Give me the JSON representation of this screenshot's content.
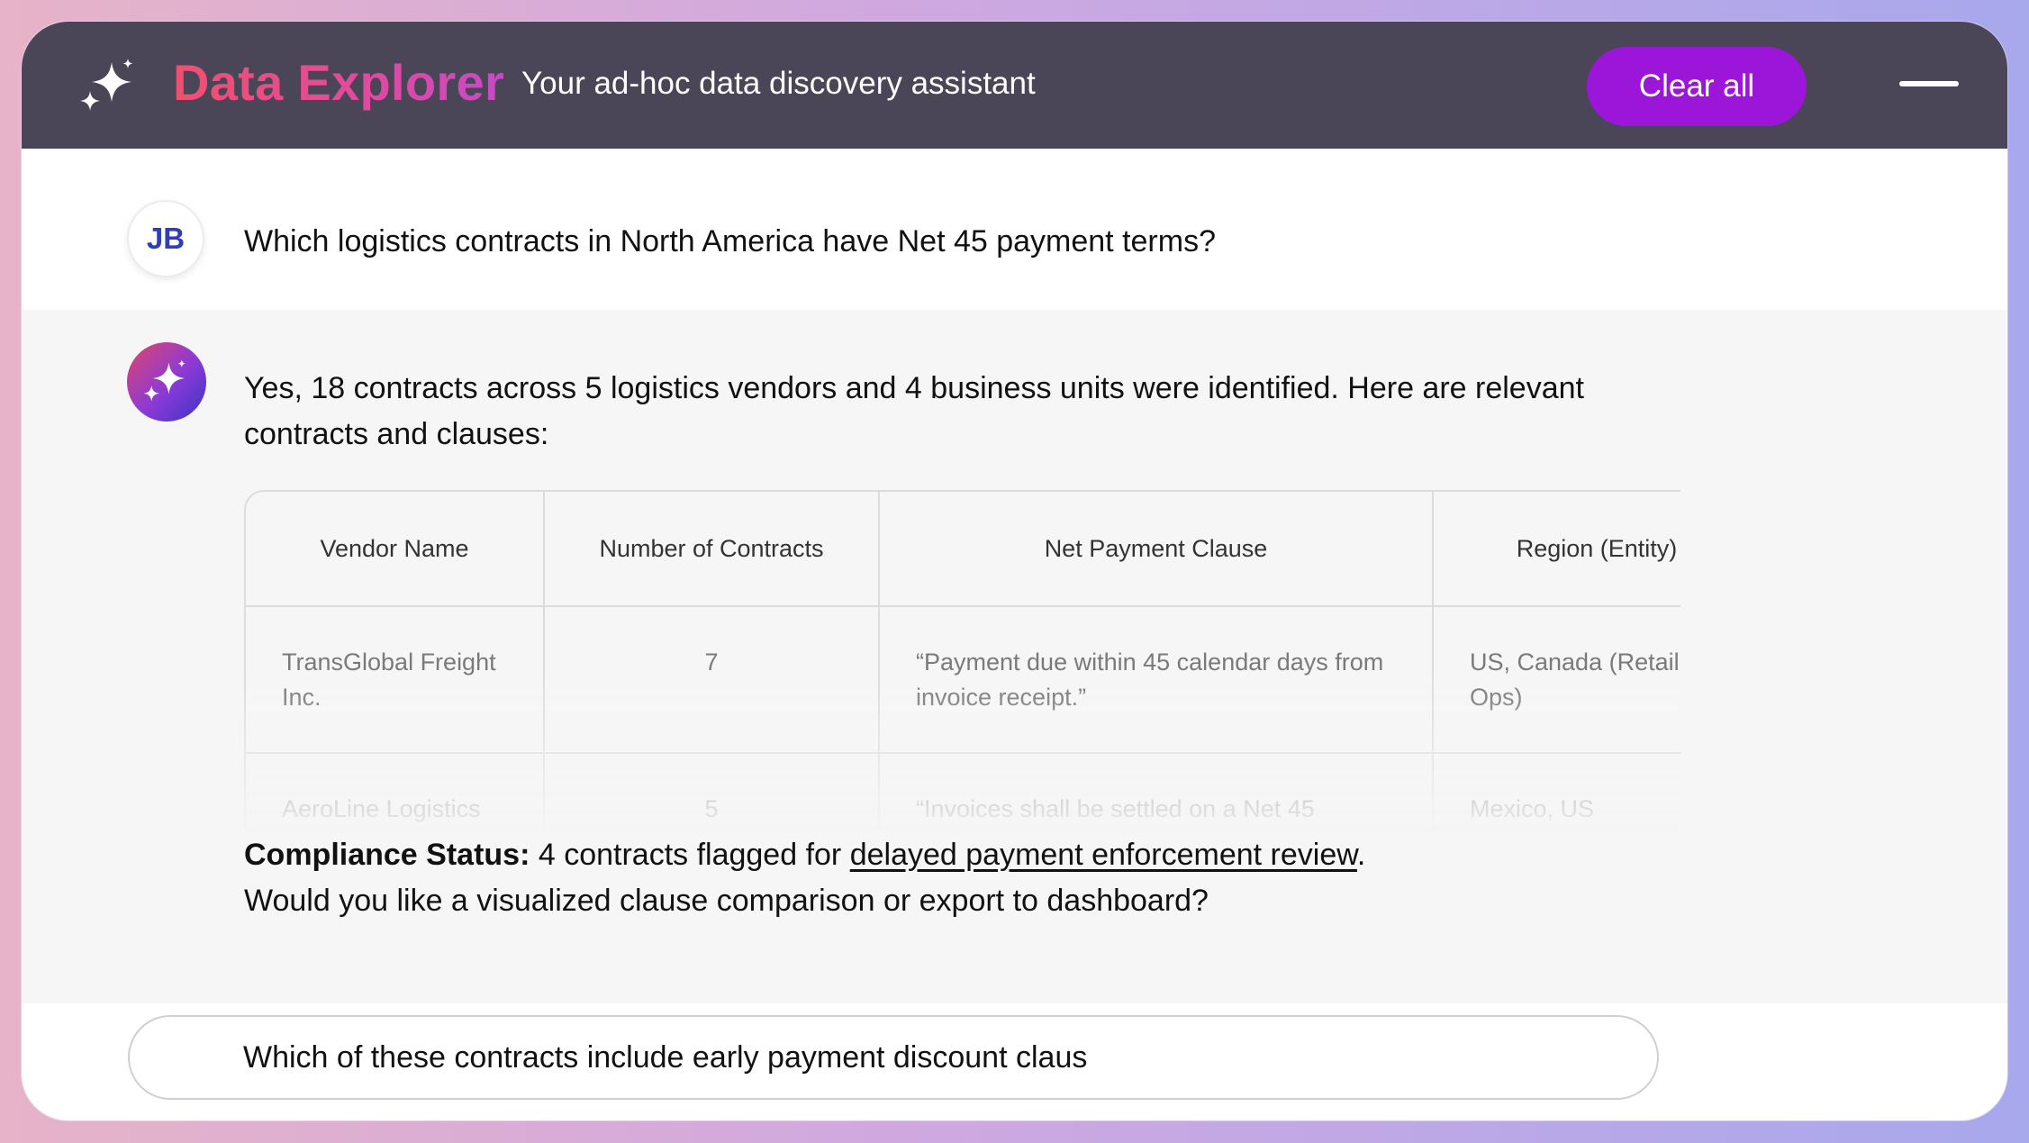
{
  "header": {
    "brand": "Data Explorer",
    "tagline": "Your ad-hoc data discovery assistant",
    "clear_label": "Clear all",
    "logo_icon": "sparkle-icon",
    "menu_icon": "menu-icon"
  },
  "conversation": {
    "user": {
      "initials": "JB",
      "message": "Which logistics contracts in North America have Net 45 payment terms?"
    },
    "assistant": {
      "avatar_icon": "sparkle-icon",
      "message": "Yes, 18 contracts across 5 logistics vendors and 4 business units were identified. Here are relevant contracts and clauses:",
      "table": {
        "columns": [
          "Vendor Name",
          "Number of Contracts",
          "Net Payment Clause",
          "Region (Entity)"
        ],
        "rows": [
          [
            "TransGlobal Freight Inc.",
            "7",
            "“Payment due within 45 calendar days from invoice receipt.”",
            "US, Canada (Retail Ops)"
          ],
          [
            "AeroLine Logistics",
            "5",
            "“Invoices shall be settled on a Net 45",
            "Mexico, US"
          ]
        ]
      },
      "compliance_label": "Compliance Status:",
      "compliance_text": " 4 contracts flagged for ",
      "compliance_link": "delayed payment enforcement review",
      "compliance_end": ".",
      "followup": "Would you like a visualized clause comparison or export to dashboard?"
    }
  },
  "composer": {
    "value": "Which of these contracts include early payment discount claus"
  },
  "colors": {
    "header_bg": "#4a4658",
    "accent_button": "#9b16d8",
    "brand_gradient_start": "#f0506e",
    "brand_gradient_end": "#c44bc6",
    "initials": "#2f3db8"
  }
}
